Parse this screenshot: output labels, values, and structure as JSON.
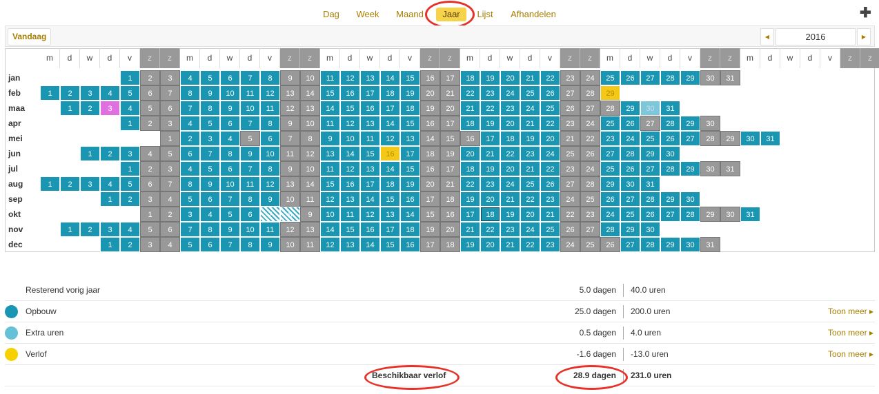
{
  "nav": {
    "tabs": [
      "Dag",
      "Week",
      "Maand",
      "Jaar",
      "Lijst",
      "Afhandelen"
    ],
    "active": "Jaar",
    "add_icon": "plus-icon"
  },
  "toolbar": {
    "today": "Vandaag",
    "year": "2016",
    "prev_icon": "chevron-left-icon",
    "next_icon": "chevron-right-icon"
  },
  "weekdays": [
    "m",
    "d",
    "w",
    "d",
    "v",
    "z",
    "z"
  ],
  "months": [
    "jan",
    "feb",
    "maa",
    "apr",
    "mei",
    "jun",
    "jul",
    "aug",
    "sep",
    "okt",
    "nov",
    "dec"
  ],
  "month_offsets": [
    4,
    0,
    1,
    4,
    6,
    2,
    4,
    0,
    3,
    5,
    1,
    3
  ],
  "month_lengths": [
    31,
    29,
    31,
    30,
    31,
    30,
    31,
    31,
    30,
    31,
    30,
    31
  ],
  "special_days": {
    "feb-29": "gold",
    "maa-3": "pink",
    "maa-30": "light",
    "jun-16": "gold",
    "maa-28": "gray",
    "apr-27": "gray",
    "mei-5": "gray",
    "mei-16": "gray",
    "okt-7": "hatch",
    "okt-8": "hatch",
    "okt-18": "today",
    "dec-26": "gray"
  },
  "summary": [
    {
      "label": "Resterend vorig jaar",
      "days": "5.0 dagen",
      "hours": "40.0 uren",
      "more": "",
      "color": ""
    },
    {
      "label": "Opbouw",
      "days": "25.0 dagen",
      "hours": "200.0 uren",
      "more": "Toon meer",
      "color": "#1a96b3"
    },
    {
      "label": "Extra uren",
      "days": "0.5 dagen",
      "hours": "4.0 uren",
      "more": "Toon meer",
      "color": "#64c1d6"
    },
    {
      "label": "Verlof",
      "days": "-1.6 dagen",
      "hours": "-13.0 uren",
      "more": "Toon meer",
      "color": "#f6d000"
    }
  ],
  "total": {
    "label": "Beschikbaar verlof",
    "days": "28.9 dagen",
    "hours": "231.0 uren"
  }
}
